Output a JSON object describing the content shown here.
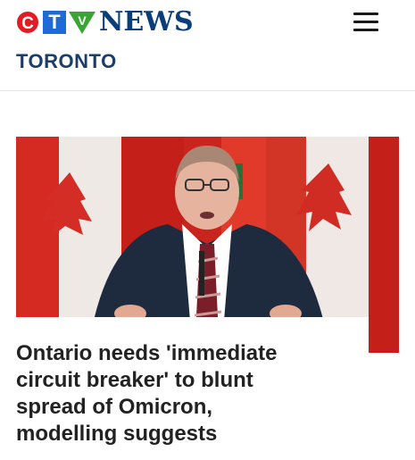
{
  "brand": {
    "logo_letters": [
      "C",
      "T",
      "V"
    ],
    "logo_word": "NEWS",
    "colors": {
      "c": "#e31b23",
      "t": "#1e6bd6",
      "v": "#3aa535",
      "news": "#0a3d7a"
    }
  },
  "header": {
    "edition": "TORONTO",
    "menu_icon": "hamburger-menu-icon"
  },
  "story": {
    "headline": "Ontario needs 'immediate circuit breaker' to blunt spread of Omicron, modelling suggests"
  }
}
